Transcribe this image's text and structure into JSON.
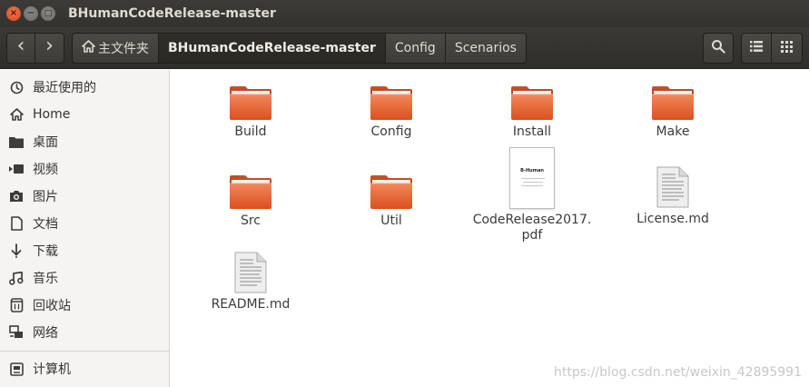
{
  "window": {
    "title": "BHumanCodeRelease-master",
    "close_glyph": "×",
    "minimize_glyph": "−",
    "maximize_glyph": "□"
  },
  "toolbar": {
    "back_glyph": "‹",
    "forward_glyph": "›",
    "breadcrumbs": [
      {
        "label": "主文件夹",
        "icon": "home-icon"
      },
      {
        "label": "BHumanCodeRelease-master"
      },
      {
        "label": "Config"
      },
      {
        "label": "Scenarios"
      }
    ],
    "search_icon": "search-icon",
    "list_view_icon": "list-view-icon",
    "grid_view_icon": "grid-view-icon"
  },
  "sidebar": {
    "items": [
      {
        "label": "最近使用的",
        "icon": "clock-icon"
      },
      {
        "label": "Home",
        "icon": "home-icon"
      },
      {
        "label": "桌面",
        "icon": "folder-icon"
      },
      {
        "label": "视频",
        "icon": "video-icon"
      },
      {
        "label": "图片",
        "icon": "camera-icon"
      },
      {
        "label": "文档",
        "icon": "document-icon"
      },
      {
        "label": "下载",
        "icon": "download-icon"
      },
      {
        "label": "音乐",
        "icon": "music-icon"
      },
      {
        "label": "回收站",
        "icon": "trash-icon"
      },
      {
        "label": "网络",
        "icon": "network-icon"
      },
      {
        "label": "计算机",
        "icon": "computer-icon"
      }
    ]
  },
  "files": [
    {
      "name": "Build",
      "type": "folder"
    },
    {
      "name": "Config",
      "type": "folder"
    },
    {
      "name": "Install",
      "type": "folder"
    },
    {
      "name": "Make",
      "type": "folder"
    },
    {
      "name": "Src",
      "type": "folder"
    },
    {
      "name": "Util",
      "type": "folder"
    },
    {
      "name": "CodeRelease2017.\npdf",
      "type": "pdf",
      "thumb_title": "B-Human"
    },
    {
      "name": "License.md",
      "type": "text"
    },
    {
      "name": "README.md",
      "type": "text"
    }
  ],
  "watermark": "https://blog.csdn.net/weixin_42895991",
  "colors": {
    "folder_top": "#f3905f",
    "folder_body": "#e25d2a",
    "titlebar": "#3c3b37",
    "close": "#e95420"
  }
}
